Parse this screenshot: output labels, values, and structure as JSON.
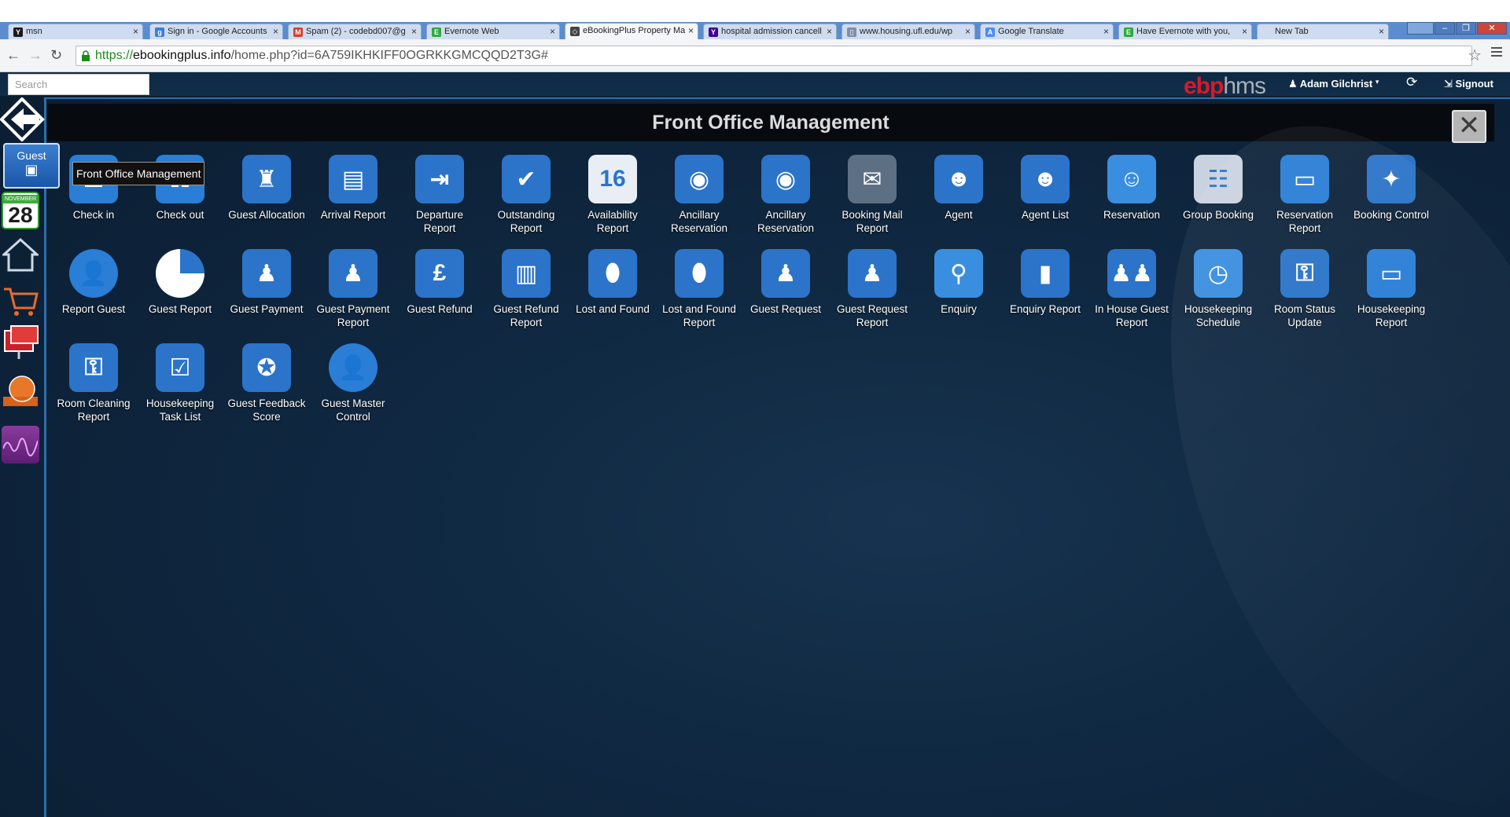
{
  "browser": {
    "tabs": [
      {
        "label": "msn",
        "fav": "Y",
        "favcolor": "#1a1a1a"
      },
      {
        "label": "Sign in - Google Accounts",
        "fav": "g",
        "favcolor": "#3a7ee0"
      },
      {
        "label": "Spam (2) - codebd007@g",
        "fav": "M",
        "favcolor": "#d23f31"
      },
      {
        "label": "Evernote Web",
        "fav": "E",
        "favcolor": "#2dab3d"
      },
      {
        "label": "eBookingPlus Property Ma",
        "fav": "◇",
        "favcolor": "#444444"
      },
      {
        "label": "hospital admission cancell",
        "fav": "Y",
        "favcolor": "#400090"
      },
      {
        "label": "www.housing.ufl.edu/wp",
        "fav": "▯",
        "favcolor": "#7d8fa6"
      },
      {
        "label": "Google Translate",
        "fav": "A",
        "favcolor": "#4c8bf5"
      },
      {
        "label": "Have Evernote with you,",
        "fav": "E",
        "favcolor": "#2dab3d"
      },
      {
        "label": "New Tab",
        "fav": "",
        "favcolor": "#cfdbee"
      }
    ],
    "active_tab": 4,
    "url": {
      "scheme": "https://",
      "host": "ebookingplus.info",
      "path": "/home.php?id=6A759IKHKIFF0OGRKKGMCQQD2T3G#"
    }
  },
  "topbar": {
    "search_placeholder": "Search",
    "brand_part1": "ebp",
    "brand_part2": "hms",
    "user_name": "Adam Gilchrist",
    "signout": "Signout"
  },
  "sidebar": {
    "guest_label": "Guest",
    "calendar_month": "NOVEMBER",
    "calendar_day": "28"
  },
  "header": {
    "title": "Front Office Management"
  },
  "tooltip": "Front Office Management",
  "tiles": [
    {
      "l1": "Check in",
      "l2": "",
      "icon": "check-in-icon",
      "color": "#2a7ed6",
      "glyph": "☰"
    },
    {
      "l1": "Check out",
      "l2": "",
      "icon": "check-out-icon",
      "color": "#2a7ed6",
      "glyph": "☷"
    },
    {
      "l1": "Guest Allocation",
      "l2": "",
      "icon": "armchair-icon",
      "color": "#2b74c9",
      "glyph": "♜"
    },
    {
      "l1": "Arrival Report",
      "l2": "",
      "icon": "briefcase-icon",
      "color": "#2b74c9",
      "glyph": "▤"
    },
    {
      "l1": "Departure",
      "l2": "Report",
      "icon": "signpost-icon",
      "color": "#2b74c9",
      "glyph": "⇥"
    },
    {
      "l1": "Outstanding",
      "l2": "Report",
      "icon": "checkbox-icon",
      "color": "#2b74c9",
      "glyph": "✔"
    },
    {
      "l1": "Availability",
      "l2": "Report",
      "icon": "calendar-icon",
      "color": "#e9eef5",
      "glyph": "16"
    },
    {
      "l1": "Ancillary",
      "l2": "Reservation",
      "icon": "wifi-icon",
      "color": "#2b74c9",
      "glyph": "◉"
    },
    {
      "l1": "Ancillary",
      "l2": "Reservation",
      "icon": "wifi-report-icon",
      "color": "#2b74c9",
      "glyph": "◉"
    },
    {
      "l1": "Booking Mail",
      "l2": "Report",
      "icon": "mail-icon",
      "color": "#5d6f83",
      "glyph": "✉"
    },
    {
      "l1": "Agent",
      "l2": "",
      "icon": "agent-icon",
      "color": "#2b74c9",
      "glyph": "☻"
    },
    {
      "l1": "Agent List",
      "l2": "",
      "icon": "agent-list-icon",
      "color": "#2b74c9",
      "glyph": "☻"
    },
    {
      "l1": "Reservation",
      "l2": "",
      "icon": "finder-icon",
      "color": "#3a8ee0",
      "glyph": "☺"
    },
    {
      "l1": "Group Booking",
      "l2": "",
      "icon": "group-icon",
      "color": "#c9d3df",
      "glyph": "☷"
    },
    {
      "l1": "Reservation",
      "l2": "Report",
      "icon": "monitor-icon",
      "color": "#2a7ed6",
      "glyph": "▭"
    },
    {
      "l1": "Booking Control",
      "l2": "",
      "icon": "compass-icon",
      "color": "#2b74c9",
      "glyph": "✦"
    },
    {
      "l1": "Report Guest",
      "l2": "",
      "icon": "person-icon",
      "color": "#2a7ed6",
      "glyph": "👤"
    },
    {
      "l1": "Guest Report",
      "l2": "",
      "icon": "pie-icon",
      "color": "#ffffff",
      "glyph": ""
    },
    {
      "l1": "Guest Payment",
      "l2": "",
      "icon": "person-money-icon",
      "color": "#2b74c9",
      "glyph": "♟"
    },
    {
      "l1": "Guest Payment",
      "l2": "Report",
      "icon": "person-card-icon",
      "color": "#2b74c9",
      "glyph": "♟"
    },
    {
      "l1": "Guest Refund",
      "l2": "",
      "icon": "pound-icon",
      "color": "#2b74c9",
      "glyph": "£"
    },
    {
      "l1": "Guest Refund",
      "l2": "Report",
      "icon": "bank-icon",
      "color": "#2b74c9",
      "glyph": "▥"
    },
    {
      "l1": "Lost and Found",
      "l2": "",
      "icon": "football-icon",
      "color": "#2b74c9",
      "glyph": "⬮"
    },
    {
      "l1": "Lost and Found",
      "l2": "Report",
      "icon": "football-report-icon",
      "color": "#2b74c9",
      "glyph": "⬮"
    },
    {
      "l1": "Guest Request",
      "l2": "",
      "icon": "person-request-icon",
      "color": "#2b74c9",
      "glyph": "♟"
    },
    {
      "l1": "Guest Request",
      "l2": "Report",
      "icon": "person-request-report-icon",
      "color": "#2b74c9",
      "glyph": "♟"
    },
    {
      "l1": "Enquiry",
      "l2": "",
      "icon": "person-search-icon",
      "color": "#3a8ee0",
      "glyph": "⚲"
    },
    {
      "l1": "Enquiry Report",
      "l2": "",
      "icon": "chart-search-icon",
      "color": "#2b74c9",
      "glyph": "▮"
    },
    {
      "l1": "In House Guest",
      "l2": "Report",
      "icon": "group-people-icon",
      "color": "#2b74c9",
      "glyph": "♟♟"
    },
    {
      "l1": "Housekeeping",
      "l2": "Schedule",
      "icon": "pillow-clock-icon",
      "color": "#3a8ee0",
      "glyph": "◷"
    },
    {
      "l1": "Room Status",
      "l2": "Update",
      "icon": "door-hanger-icon",
      "color": "#2b74c9",
      "glyph": "⚿"
    },
    {
      "l1": "Housekeeping",
      "l2": "Report",
      "icon": "monitor-report-icon",
      "color": "#2a7ed6",
      "glyph": "▭"
    },
    {
      "l1": "Room Cleaning",
      "l2": "Report",
      "icon": "cleaning-report-icon",
      "color": "#2b74c9",
      "glyph": "⚿"
    },
    {
      "l1": "Housekeeping",
      "l2": "Task List",
      "icon": "checklist-icon",
      "color": "#2b74c9",
      "glyph": "☑"
    },
    {
      "l1": "Guest Feedback",
      "l2": "Score",
      "icon": "award-icon",
      "color": "#2b74c9",
      "glyph": "✪"
    },
    {
      "l1": "Guest Master",
      "l2": "Control",
      "icon": "person-master-icon",
      "color": "#2a7ed6",
      "glyph": "👤"
    }
  ]
}
